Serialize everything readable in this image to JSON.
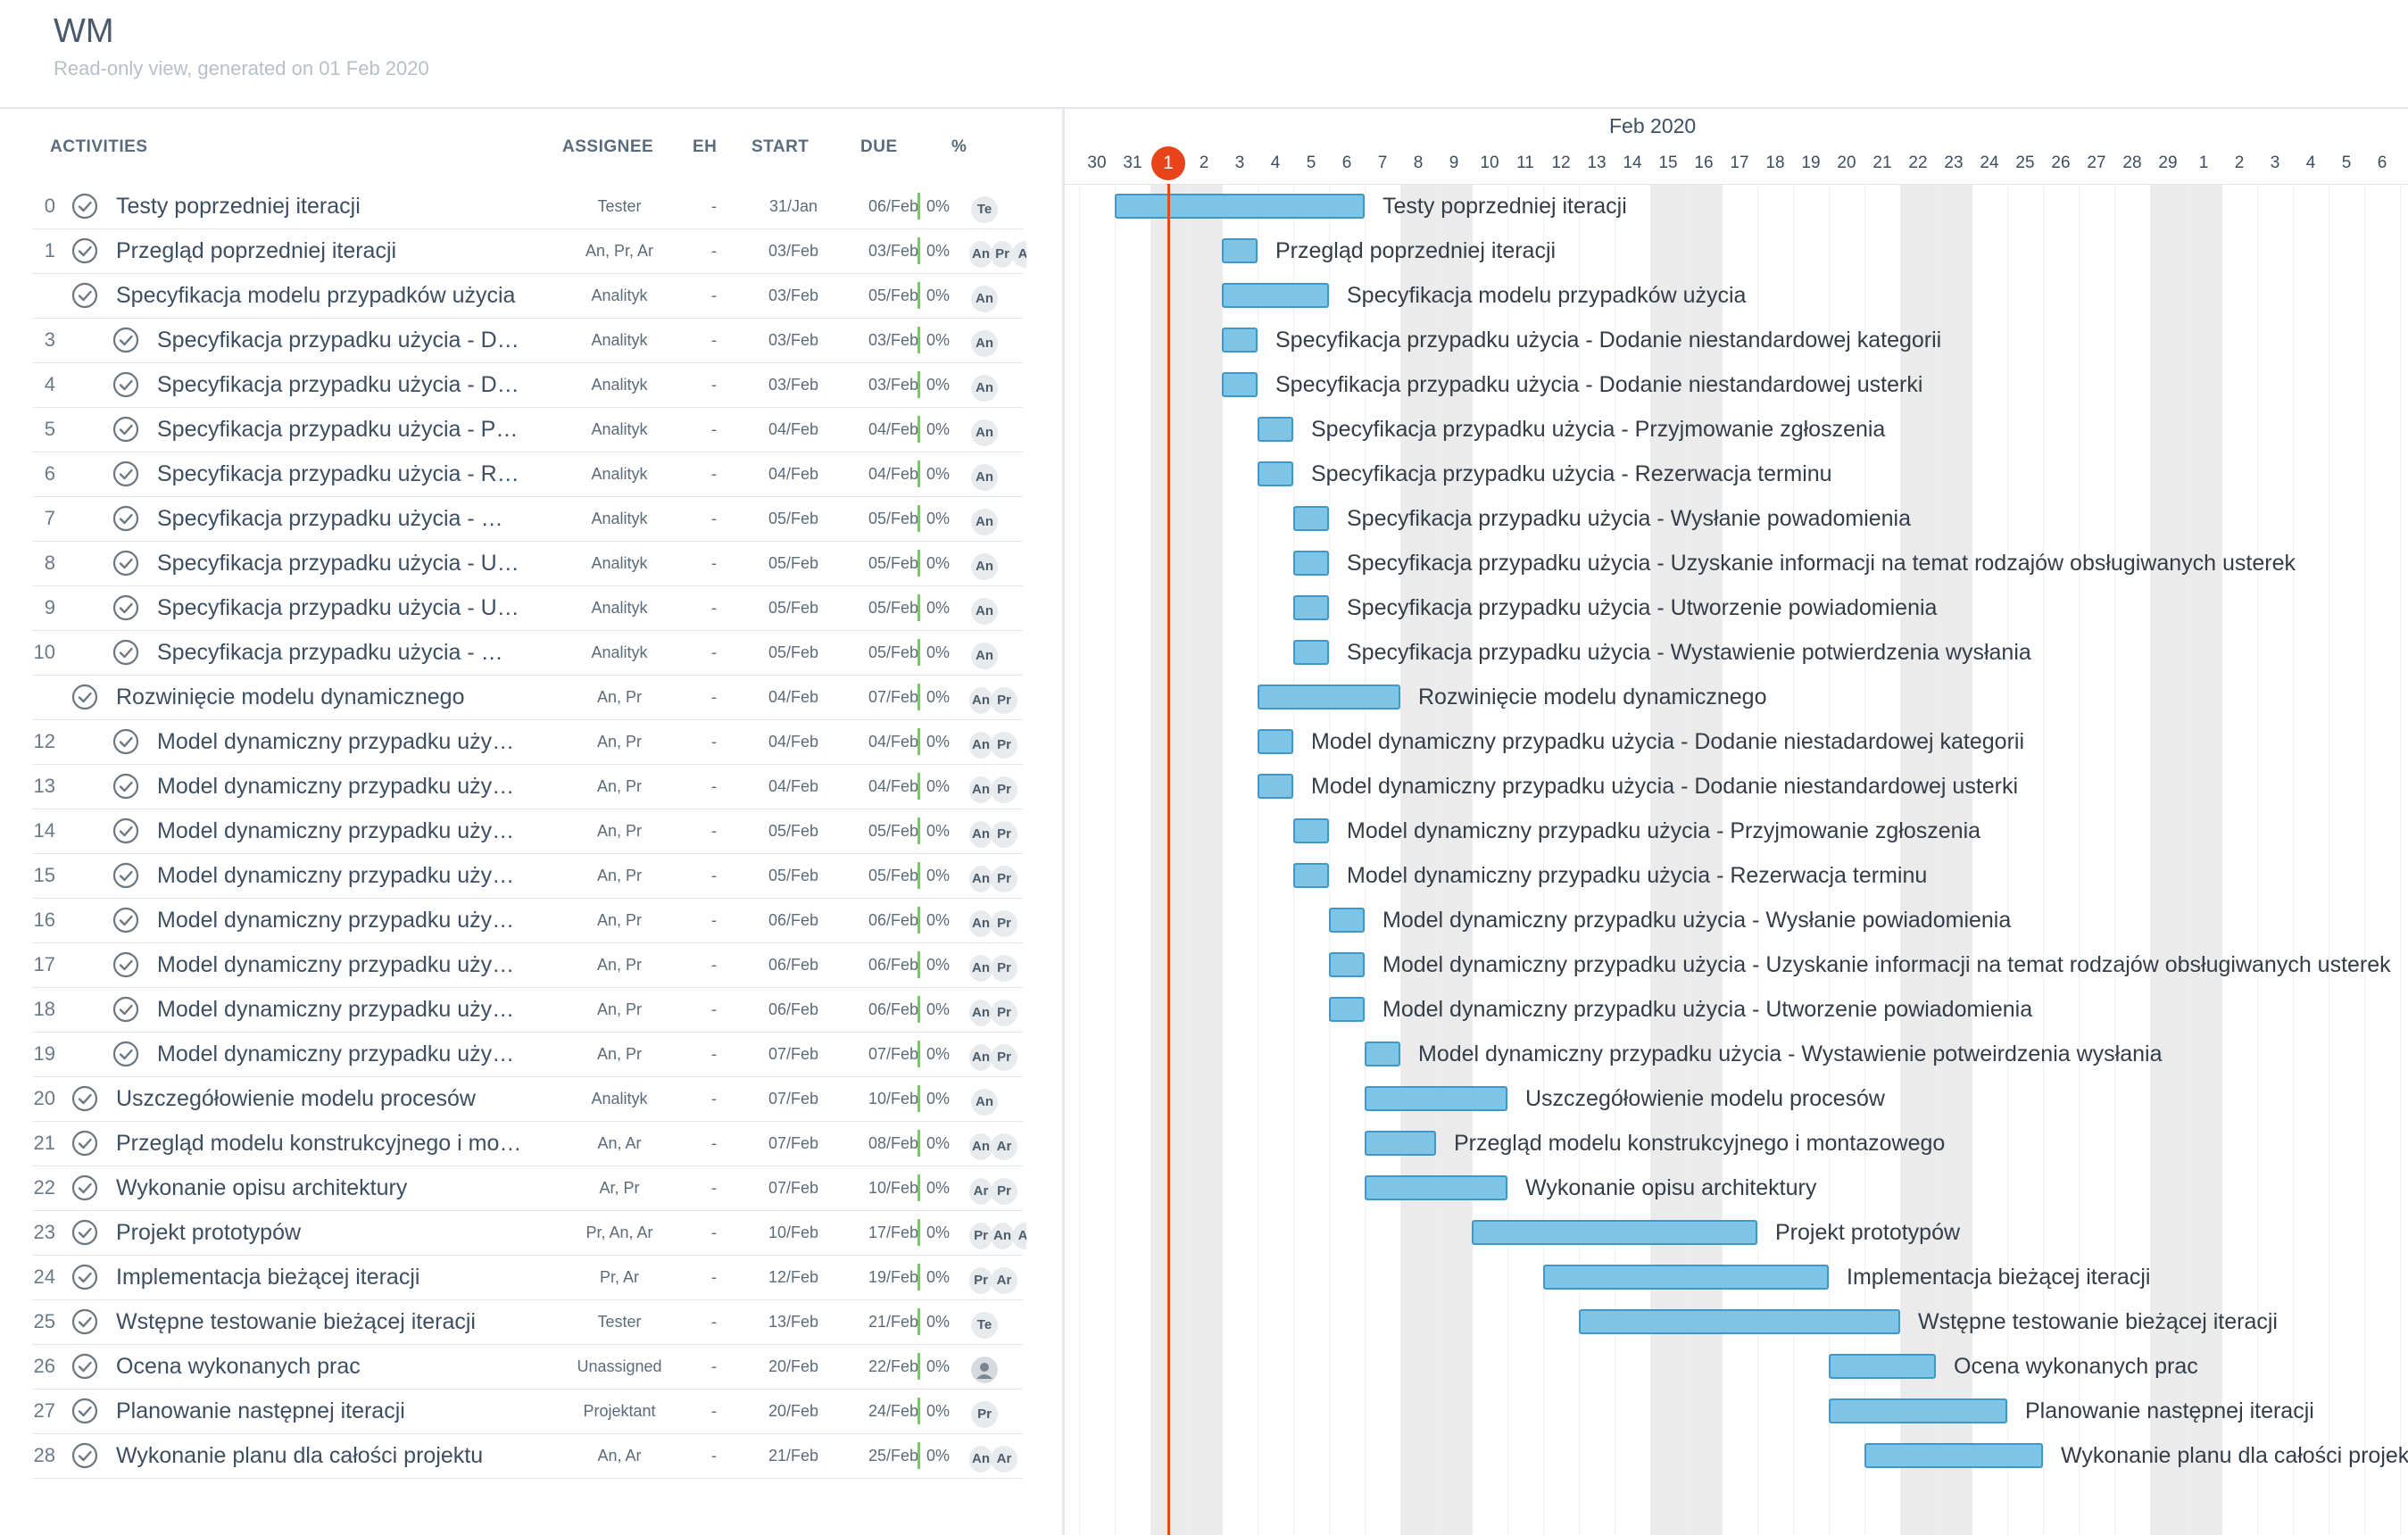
{
  "header": {
    "title": "WM",
    "subtitle": "Read-only view, generated on 01 Feb 2020"
  },
  "table": {
    "columns": {
      "activities": "ACTIVITIES",
      "assignee": "ASSIGNEE",
      "eh": "EH",
      "start": "START",
      "due": "DUE",
      "pct": "%"
    },
    "tasks": [
      {
        "num": "0",
        "indent": 0,
        "name": "Testy poprzedniej iteracji",
        "assignee": "Tester",
        "eh": "-",
        "start": "31/Jan",
        "due": "06/Feb",
        "pct": "0%",
        "avatars": [
          "Te"
        ]
      },
      {
        "num": "1",
        "indent": 0,
        "name": "Przegląd poprzedniej iteracji",
        "assignee": "An, Pr, Ar",
        "eh": "-",
        "start": "03/Feb",
        "due": "03/Feb",
        "pct": "0%",
        "avatars": [
          "An",
          "Pr",
          "Ar"
        ]
      },
      {
        "num": "",
        "indent": 0,
        "name": "Specyfikacja modelu przypadków użycia",
        "assignee": "Analityk",
        "eh": "-",
        "start": "03/Feb",
        "due": "05/Feb",
        "pct": "0%",
        "avatars": [
          "An"
        ]
      },
      {
        "num": "3",
        "indent": 1,
        "name": "Specyfikacja przypadku użycia - Dodanie niestandardowej kategorii",
        "assignee": "Analityk",
        "eh": "-",
        "start": "03/Feb",
        "due": "03/Feb",
        "pct": "0%",
        "avatars": [
          "An"
        ]
      },
      {
        "num": "4",
        "indent": 1,
        "name": "Specyfikacja przypadku użycia - Dodanie niestandardowej usterki",
        "assignee": "Analityk",
        "eh": "-",
        "start": "03/Feb",
        "due": "03/Feb",
        "pct": "0%",
        "avatars": [
          "An"
        ]
      },
      {
        "num": "5",
        "indent": 1,
        "name": "Specyfikacja przypadku użycia - Przyjmowanie zgłoszenia",
        "assignee": "Analityk",
        "eh": "-",
        "start": "04/Feb",
        "due": "04/Feb",
        "pct": "0%",
        "avatars": [
          "An"
        ]
      },
      {
        "num": "6",
        "indent": 1,
        "name": "Specyfikacja przypadku użycia - Rezerwacja terminu",
        "assignee": "Analityk",
        "eh": "-",
        "start": "04/Feb",
        "due": "04/Feb",
        "pct": "0%",
        "avatars": [
          "An"
        ]
      },
      {
        "num": "7",
        "indent": 1,
        "name": "Specyfikacja przypadku użycia - Wysłanie powadomienia",
        "assignee": "Analityk",
        "eh": "-",
        "start": "05/Feb",
        "due": "05/Feb",
        "pct": "0%",
        "avatars": [
          "An"
        ]
      },
      {
        "num": "8",
        "indent": 1,
        "name": "Specyfikacja przypadku użycia - Uzyskanie informacji na temat rodzajów obsługiwanych usterek",
        "assignee": "Analityk",
        "eh": "-",
        "start": "05/Feb",
        "due": "05/Feb",
        "pct": "0%",
        "avatars": [
          "An"
        ]
      },
      {
        "num": "9",
        "indent": 1,
        "name": "Specyfikacja przypadku użycia - Utworzenie powiadomienia",
        "assignee": "Analityk",
        "eh": "-",
        "start": "05/Feb",
        "due": "05/Feb",
        "pct": "0%",
        "avatars": [
          "An"
        ]
      },
      {
        "num": "10",
        "indent": 1,
        "name": "Specyfikacja przypadku użycia - Wystawienie potwierdzenia wysłania",
        "assignee": "Analityk",
        "eh": "-",
        "start": "05/Feb",
        "due": "05/Feb",
        "pct": "0%",
        "avatars": [
          "An"
        ]
      },
      {
        "num": "",
        "indent": 0,
        "name": "Rozwinięcie modelu dynamicznego",
        "assignee": "An, Pr",
        "eh": "-",
        "start": "04/Feb",
        "due": "07/Feb",
        "pct": "0%",
        "avatars": [
          "An",
          "Pr"
        ]
      },
      {
        "num": "12",
        "indent": 1,
        "name": "Model dynamiczny przypadku użycia - Dodanie niestadardowej kategorii",
        "assignee": "An, Pr",
        "eh": "-",
        "start": "04/Feb",
        "due": "04/Feb",
        "pct": "0%",
        "avatars": [
          "An",
          "Pr"
        ]
      },
      {
        "num": "13",
        "indent": 1,
        "name": "Model dynamiczny przypadku użycia - Dodanie niestandardowej usterki",
        "assignee": "An, Pr",
        "eh": "-",
        "start": "04/Feb",
        "due": "04/Feb",
        "pct": "0%",
        "avatars": [
          "An",
          "Pr"
        ]
      },
      {
        "num": "14",
        "indent": 1,
        "name": "Model dynamiczny przypadku użycia - Przyjmowanie zgłoszenia",
        "assignee": "An, Pr",
        "eh": "-",
        "start": "05/Feb",
        "due": "05/Feb",
        "pct": "0%",
        "avatars": [
          "An",
          "Pr"
        ]
      },
      {
        "num": "15",
        "indent": 1,
        "name": "Model dynamiczny przypadku użycia - Rezerwacja terminu",
        "assignee": "An, Pr",
        "eh": "-",
        "start": "05/Feb",
        "due": "05/Feb",
        "pct": "0%",
        "avatars": [
          "An",
          "Pr"
        ]
      },
      {
        "num": "16",
        "indent": 1,
        "name": "Model dynamiczny przypadku użycia - Wysłanie powiadomienia",
        "assignee": "An, Pr",
        "eh": "-",
        "start": "06/Feb",
        "due": "06/Feb",
        "pct": "0%",
        "avatars": [
          "An",
          "Pr"
        ]
      },
      {
        "num": "17",
        "indent": 1,
        "name": "Model dynamiczny przypadku użycia - Uzyskanie informacji na temat rodzajów obsługiwanych usterek",
        "assignee": "An, Pr",
        "eh": "-",
        "start": "06/Feb",
        "due": "06/Feb",
        "pct": "0%",
        "avatars": [
          "An",
          "Pr"
        ]
      },
      {
        "num": "18",
        "indent": 1,
        "name": "Model dynamiczny przypadku użycia - Utworzenie powiadomienia",
        "assignee": "An, Pr",
        "eh": "-",
        "start": "06/Feb",
        "due": "06/Feb",
        "pct": "0%",
        "avatars": [
          "An",
          "Pr"
        ]
      },
      {
        "num": "19",
        "indent": 1,
        "name": "Model dynamiczny przypadku użycia - Wystawienie potweirdzenia wysłania",
        "assignee": "An, Pr",
        "eh": "-",
        "start": "07/Feb",
        "due": "07/Feb",
        "pct": "0%",
        "avatars": [
          "An",
          "Pr"
        ]
      },
      {
        "num": "20",
        "indent": 0,
        "name": "Uszczegółowienie modelu procesów",
        "assignee": "Analityk",
        "eh": "-",
        "start": "07/Feb",
        "due": "10/Feb",
        "pct": "0%",
        "avatars": [
          "An"
        ]
      },
      {
        "num": "21",
        "indent": 0,
        "name": "Przegląd modelu konstrukcyjnego i montazowego",
        "assignee": "An, Ar",
        "eh": "-",
        "start": "07/Feb",
        "due": "08/Feb",
        "pct": "0%",
        "avatars": [
          "An",
          "Ar"
        ]
      },
      {
        "num": "22",
        "indent": 0,
        "name": "Wykonanie opisu architektury",
        "assignee": "Ar, Pr",
        "eh": "-",
        "start": "07/Feb",
        "due": "10/Feb",
        "pct": "0%",
        "avatars": [
          "Ar",
          "Pr"
        ]
      },
      {
        "num": "23",
        "indent": 0,
        "name": "Projekt prototypów",
        "assignee": "Pr, An, Ar",
        "eh": "-",
        "start": "10/Feb",
        "due": "17/Feb",
        "pct": "0%",
        "avatars": [
          "Pr",
          "An",
          "Ar"
        ]
      },
      {
        "num": "24",
        "indent": 0,
        "name": "Implementacja bieżącej iteracji",
        "assignee": "Pr, Ar",
        "eh": "-",
        "start": "12/Feb",
        "due": "19/Feb",
        "pct": "0%",
        "avatars": [
          "Pr",
          "Ar"
        ]
      },
      {
        "num": "25",
        "indent": 0,
        "name": "Wstępne testowanie bieżącej iteracji",
        "assignee": "Tester",
        "eh": "-",
        "start": "13/Feb",
        "due": "21/Feb",
        "pct": "0%",
        "avatars": [
          "Te"
        ]
      },
      {
        "num": "26",
        "indent": 0,
        "name": "Ocena wykonanych prac",
        "assignee": "Unassigned",
        "eh": "-",
        "start": "20/Feb",
        "due": "22/Feb",
        "pct": "0%",
        "avatars": [
          "user-icon"
        ]
      },
      {
        "num": "27",
        "indent": 0,
        "name": "Planowanie następnej iteracji",
        "assignee": "Projektant",
        "eh": "-",
        "start": "20/Feb",
        "due": "24/Feb",
        "pct": "0%",
        "avatars": [
          "Pr"
        ]
      },
      {
        "num": "28",
        "indent": 0,
        "name": "Wykonanie planu dla całości projektu",
        "assignee": "An, Ar",
        "eh": "-",
        "start": "21/Feb",
        "due": "25/Feb",
        "pct": "0%",
        "avatars": [
          "An",
          "Ar"
        ]
      }
    ]
  },
  "gantt": {
    "month": "Feb 2020",
    "today": "1",
    "days": [
      "30",
      "31",
      "1",
      "2",
      "3",
      "4",
      "5",
      "6",
      "7",
      "8",
      "9",
      "10",
      "11",
      "12",
      "13",
      "14",
      "15",
      "16",
      "17",
      "18",
      "19",
      "20",
      "21",
      "22",
      "23",
      "24",
      "25",
      "26",
      "27",
      "28",
      "29",
      "1",
      "2",
      "3",
      "4",
      "5",
      "6",
      "7"
    ],
    "colors": {
      "bar_fill": "#7ec4e6",
      "bar_border": "#3f98c9",
      "today": "#e8431b",
      "weekend": "#ebebeb"
    }
  }
}
